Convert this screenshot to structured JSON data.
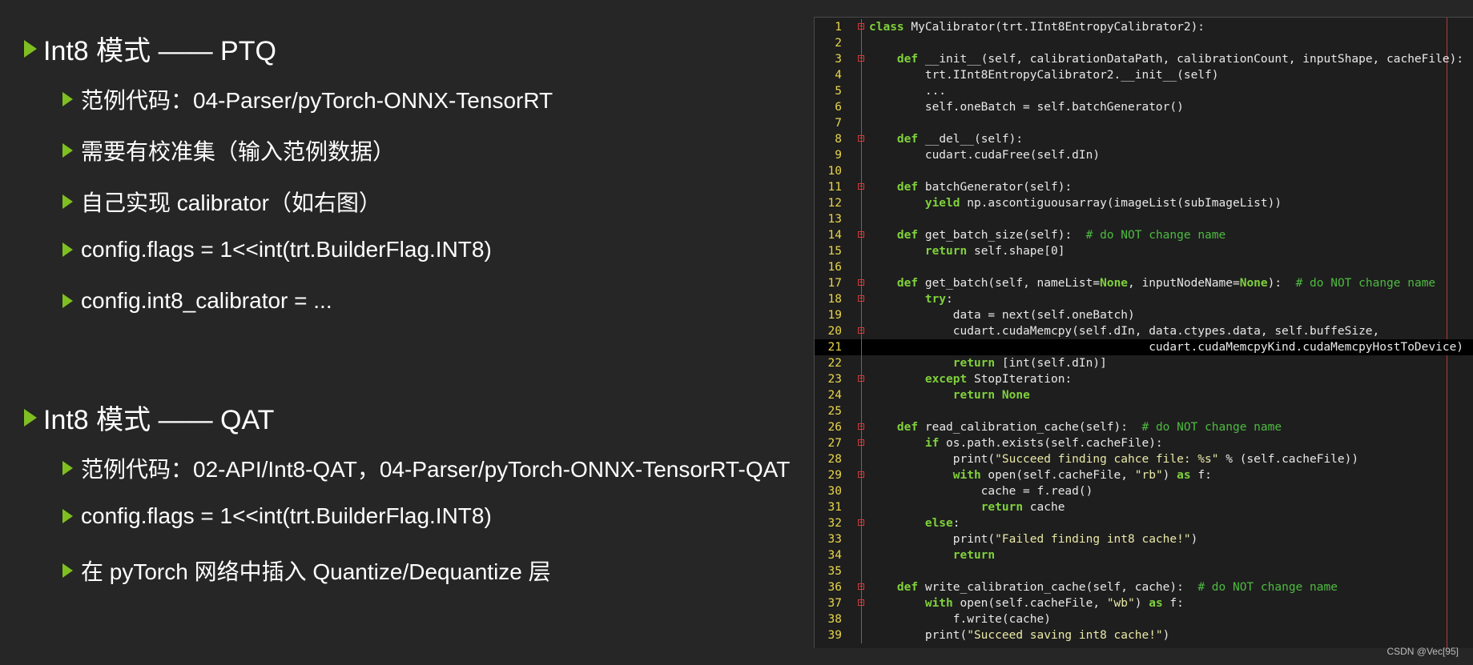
{
  "slide": {
    "bullets": [
      {
        "level": 1,
        "text": "Int8 模式 —— PTQ"
      },
      {
        "level": 2,
        "text": "范例代码：04-Parser/pyTorch-ONNX-TensorRT"
      },
      {
        "level": 2,
        "text": "需要有校准集（输入范例数据）"
      },
      {
        "level": 2,
        "text": "自己实现 calibrator（如右图）"
      },
      {
        "level": 2,
        "text": "config.flags = 1<<int(trt.BuilderFlag.INT8)"
      },
      {
        "level": 2,
        "text": "config.int8_calibrator = ..."
      },
      {
        "level": 1,
        "text": "Int8 模式 —— QAT"
      },
      {
        "level": 2,
        "text": "范例代码：02-API/Int8-QAT，04-Parser/pyTorch-ONNX-TensorRT-QAT"
      },
      {
        "level": 2,
        "text": "config.flags = 1<<int(trt.BuilderFlag.INT8)"
      },
      {
        "level": 2,
        "text": "在 pyTorch 网络中插入 Quantize/Dequantize 层"
      }
    ],
    "bullet_color": "#7fbf21"
  },
  "code": {
    "highlighted_line": 21,
    "lines": [
      {
        "n": "1",
        "fold": true,
        "text": "class MyCalibrator(trt.IInt8EntropyCalibrator2):"
      },
      {
        "n": "2",
        "fold": false,
        "text": ""
      },
      {
        "n": "3",
        "fold": true,
        "text": "    def __init__(self, calibrationDataPath, calibrationCount, inputShape, cacheFile):"
      },
      {
        "n": "4",
        "fold": false,
        "text": "        trt.IInt8EntropyCalibrator2.__init__(self)"
      },
      {
        "n": "5",
        "fold": false,
        "text": "        ..."
      },
      {
        "n": "6",
        "fold": false,
        "text": "        self.oneBatch = self.batchGenerator()"
      },
      {
        "n": "7",
        "fold": false,
        "text": ""
      },
      {
        "n": "8",
        "fold": true,
        "text": "    def __del__(self):"
      },
      {
        "n": "9",
        "fold": false,
        "text": "        cudart.cudaFree(self.dIn)"
      },
      {
        "n": "10",
        "fold": false,
        "text": ""
      },
      {
        "n": "11",
        "fold": true,
        "text": "    def batchGenerator(self):"
      },
      {
        "n": "12",
        "fold": false,
        "text": "        yield np.ascontiguousarray(imageList(subImageList))"
      },
      {
        "n": "13",
        "fold": false,
        "text": ""
      },
      {
        "n": "14",
        "fold": true,
        "text": "    def get_batch_size(self):  # do NOT change name"
      },
      {
        "n": "15",
        "fold": false,
        "text": "        return self.shape[0]"
      },
      {
        "n": "16",
        "fold": false,
        "text": ""
      },
      {
        "n": "17",
        "fold": true,
        "text": "    def get_batch(self, nameList=None, inputNodeName=None):  # do NOT change name"
      },
      {
        "n": "18",
        "fold": true,
        "text": "        try:"
      },
      {
        "n": "19",
        "fold": false,
        "text": "            data = next(self.oneBatch)"
      },
      {
        "n": "20",
        "fold": true,
        "text": "            cudart.cudaMemcpy(self.dIn, data.ctypes.data, self.buffeSize,"
      },
      {
        "n": "21",
        "fold": false,
        "text": "                                        cudart.cudaMemcpyKind.cudaMemcpyHostToDevice)"
      },
      {
        "n": "22",
        "fold": false,
        "text": "            return [int(self.dIn)]"
      },
      {
        "n": "23",
        "fold": true,
        "text": "        except StopIteration:"
      },
      {
        "n": "24",
        "fold": false,
        "text": "            return None"
      },
      {
        "n": "25",
        "fold": false,
        "text": ""
      },
      {
        "n": "26",
        "fold": true,
        "text": "    def read_calibration_cache(self):  # do NOT change name"
      },
      {
        "n": "27",
        "fold": true,
        "text": "        if os.path.exists(self.cacheFile):"
      },
      {
        "n": "28",
        "fold": false,
        "text": "            print(\"Succeed finding cahce file: %s\" % (self.cacheFile))"
      },
      {
        "n": "29",
        "fold": true,
        "text": "            with open(self.cacheFile, \"rb\") as f:"
      },
      {
        "n": "30",
        "fold": false,
        "text": "                cache = f.read()"
      },
      {
        "n": "31",
        "fold": false,
        "text": "                return cache"
      },
      {
        "n": "32",
        "fold": true,
        "text": "        else:"
      },
      {
        "n": "33",
        "fold": false,
        "text": "            print(\"Failed finding int8 cache!\")"
      },
      {
        "n": "34",
        "fold": false,
        "text": "            return"
      },
      {
        "n": "35",
        "fold": false,
        "text": ""
      },
      {
        "n": "36",
        "fold": true,
        "text": "    def write_calibration_cache(self, cache):  # do NOT change name"
      },
      {
        "n": "37",
        "fold": true,
        "text": "        with open(self.cacheFile, \"wb\") as f:"
      },
      {
        "n": "38",
        "fold": false,
        "text": "            f.write(cache)"
      },
      {
        "n": "39",
        "fold": false,
        "text": "        print(\"Succeed saving int8 cache!\")"
      }
    ]
  },
  "watermark": "CSDN @Vec[95]"
}
